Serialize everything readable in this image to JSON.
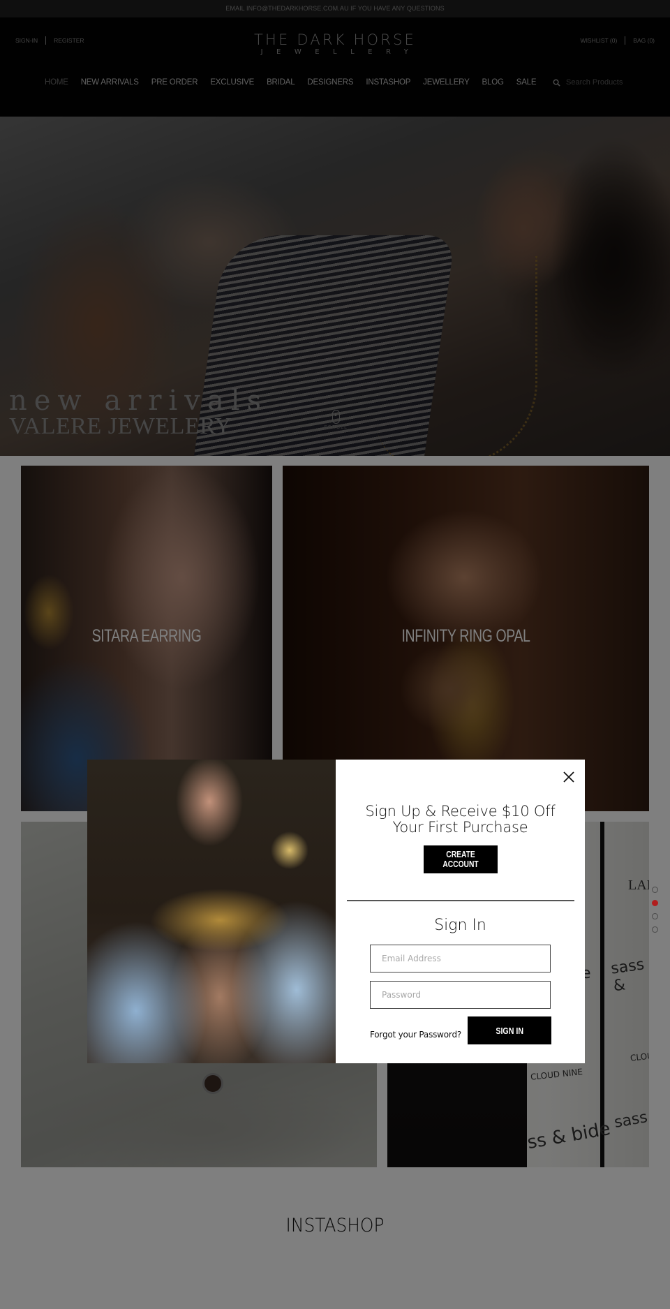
{
  "announcement": {
    "text": "EMAIL INFO@THEDARKHORSE.COM.AU IF YOU HAVE ANY QUESTIONS"
  },
  "header": {
    "account_left": [
      {
        "label": "SIGN-IN"
      },
      {
        "label": "REGISTER"
      }
    ],
    "account_right": [
      {
        "label": "WISHLIST (0)"
      },
      {
        "label": "BAG (0)"
      }
    ],
    "logo": {
      "main": "THE DARK HORSE",
      "sub": "JEWELLERY"
    },
    "nav": [
      {
        "label": "HOME",
        "active": true
      },
      {
        "label": "NEW ARRIVALS"
      },
      {
        "label": "PRE ORDER"
      },
      {
        "label": "EXCLUSIVE"
      },
      {
        "label": "BRIDAL"
      },
      {
        "label": "DESIGNERS"
      },
      {
        "label": "INSTASHOP"
      },
      {
        "label": "JEWELLERY"
      },
      {
        "label": "BLOG"
      },
      {
        "label": "SALE"
      }
    ],
    "search": {
      "placeholder": "Search Products",
      "value": "",
      "icon": "search-icon"
    }
  },
  "hero": {
    "title_line1": "new arrivals",
    "title_line2": "VALERE JEWELERY",
    "scroll_label": "SCROLL"
  },
  "products": [
    {
      "label": "SITARA EARRING"
    },
    {
      "label": "INFINITY RING OPAL"
    },
    {
      "label": ""
    },
    {
      "label": ""
    }
  ],
  "card4_signage": [
    "LANC",
    "sass &",
    "e",
    "CLOUD NINE",
    "CLOU",
    "ss & bide",
    "sass"
  ],
  "slider": {
    "total": 4,
    "active_index": 1
  },
  "instashop": {
    "heading": "INSTASHOP"
  },
  "modal": {
    "headline_line1": "Sign Up & Receive $10 Off",
    "headline_line2": "Your First Purchase",
    "create_account_label": "CREATE ACCOUNT",
    "signin_title": "Sign In",
    "email": {
      "placeholder": "Email Address",
      "value": ""
    },
    "password": {
      "placeholder": "Password",
      "value": ""
    },
    "forgot_label": "Forgot your Password?",
    "signin_label": "SIGN IN",
    "close_icon": "close-icon"
  },
  "colors": {
    "announcement_bg": "#1e1e1e",
    "header_bg": "#020202",
    "overlay": "rgba(0,0,0,0.5)",
    "slider_active": "#b11e1e",
    "button_bg": "#000000"
  }
}
